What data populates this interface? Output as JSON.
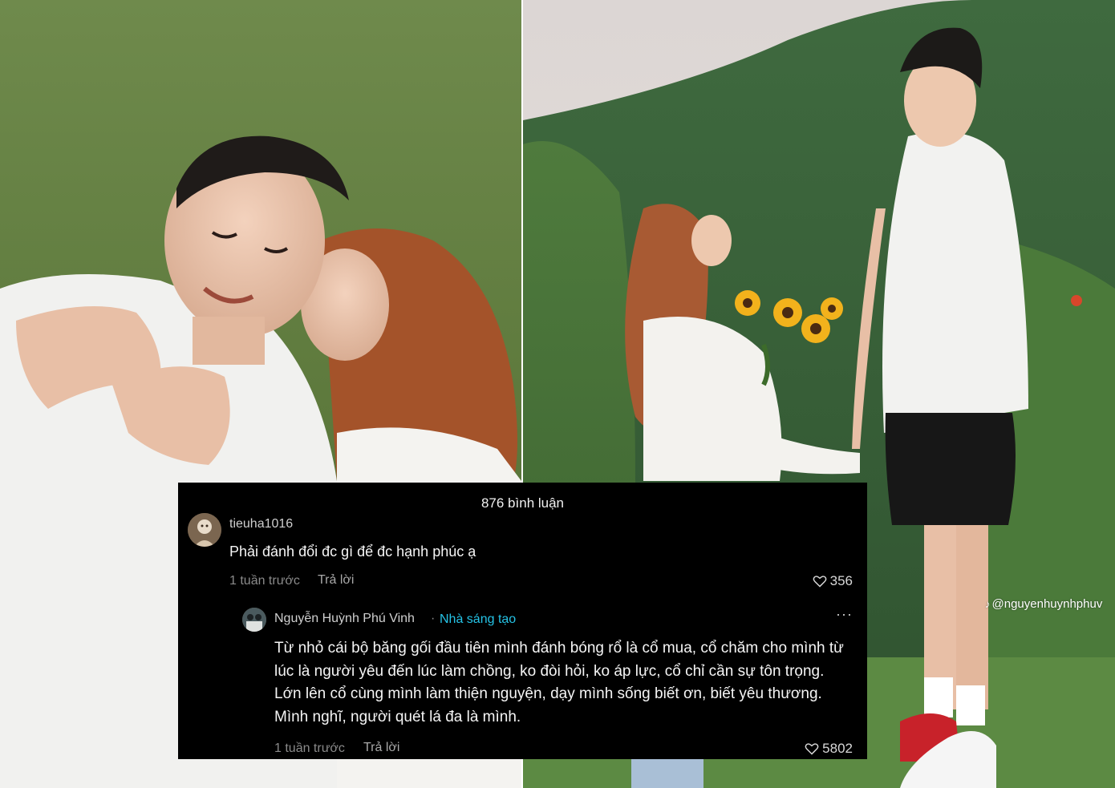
{
  "watermark": {
    "icon": "tiktok-icon",
    "handle": "@nguyenhuynhphuv"
  },
  "comments_panel": {
    "title": "876 bình luận",
    "comments": [
      {
        "username": "tieuha1016",
        "avatar": "user-avatar",
        "text": "Phải đánh đổi đc gì để đc hạnh phúc ạ",
        "time": "1 tuần trước",
        "reply_label": "Trả lời",
        "likes": "356"
      }
    ],
    "reply": {
      "username": "Nguyễn Huỳnh Phú Vinh",
      "separator": "·",
      "badge": "Nhà sáng tạo",
      "more": "···",
      "text": "Từ nhỏ cái bộ băng gối đầu tiên mình đánh bóng rổ là cổ mua, cổ chăm cho mình từ lúc là người yêu đến lúc làm chồng, ko đòi hỏi, ko áp lực, cổ chỉ cần sự tôn trọng. Lớn lên cổ cùng mình làm thiện nguyện, dạy mình sống biết ơn, biết yêu thương. Mình nghĩ, người quét lá đa là mình.",
      "time": "1 tuần trước",
      "reply_label": "Trả lời",
      "likes": "5802"
    }
  },
  "colors": {
    "panel_bg": "#000000",
    "creator_badge": "#25c3e6",
    "meta_text": "#8a8a8a"
  }
}
